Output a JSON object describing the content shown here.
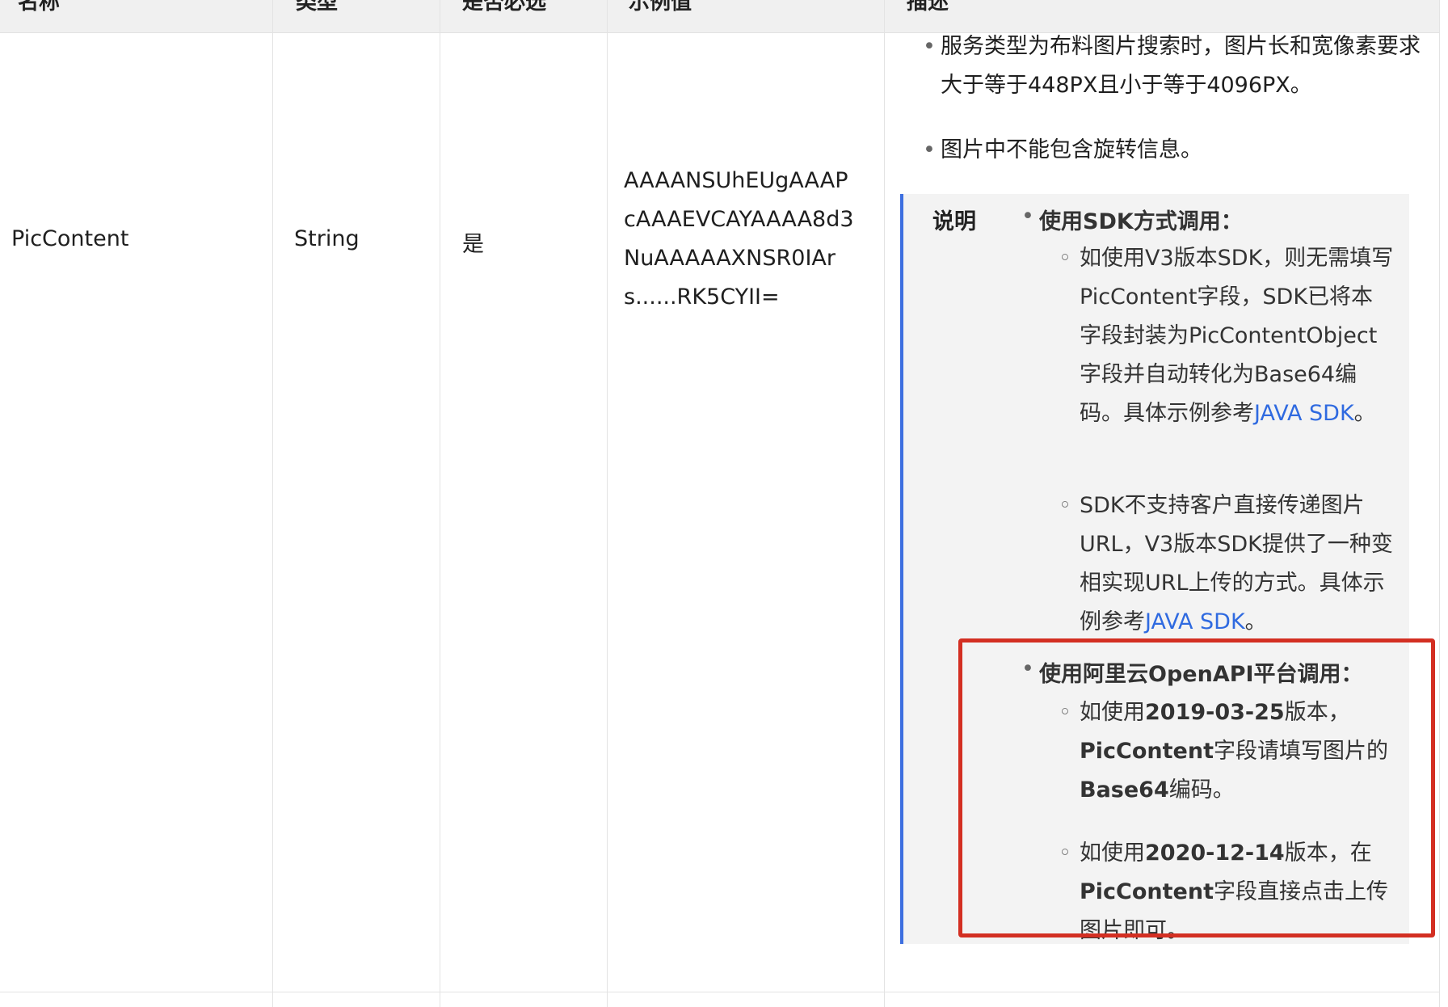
{
  "header": {
    "cols": [
      "名称",
      "类型",
      "是否必选",
      "示例值",
      "描述"
    ]
  },
  "row": {
    "name": "PicContent",
    "type": "String",
    "required": "是",
    "example": "AAAANSUhEUgAAAPcAAAEVCAYAAAA8d3NuAAAAAXNSR0IArs......RK5CYII="
  },
  "description": {
    "bullets": [
      "服务类型为布料图片搜索时，图片长和宽像素要求大于等于448PX且小于等于4096PX。",
      "图片中不能包含旋转信息。"
    ],
    "note": {
      "label": "说明",
      "sdk": {
        "title": "使用SDK方式调用：",
        "item1_text": "如使用V3版本SDK，则无需填写PicContent字段，SDK已将本字段封装为PicContentObject字段并自动转化为Base64编码。具体示例参考",
        "item1_link": "JAVA SDK",
        "item1_end": "。",
        "item2_text": "SDK不支持客户直接传递图片URL，V3版本SDK提供了一种变相实现URL上传的方式。具体示例参考",
        "item2_link": "JAVA SDK",
        "item2_end": "。"
      },
      "openapi": {
        "title": "使用阿里云OpenAPI平台调用：",
        "item1_a": "如使用",
        "item1_version": "2019-03-25",
        "item1_b": "版本，",
        "item1_field": "PicContent",
        "item1_c": "字段请填写图片的",
        "item1_encoding": "Base64",
        "item1_d": "编码。",
        "item2_a": "如使用",
        "item2_version": "2020-12-14",
        "item2_b": "版本，在",
        "item2_field": "PicContent",
        "item2_c": "字段直接点击上传图片即可。"
      }
    }
  },
  "colors": {
    "header_bg": "#f0f0f0",
    "note_bg": "#f3f3f3",
    "note_border": "#3d6fe0",
    "link": "#2f6ae0",
    "highlight_box": "#d32f22"
  }
}
